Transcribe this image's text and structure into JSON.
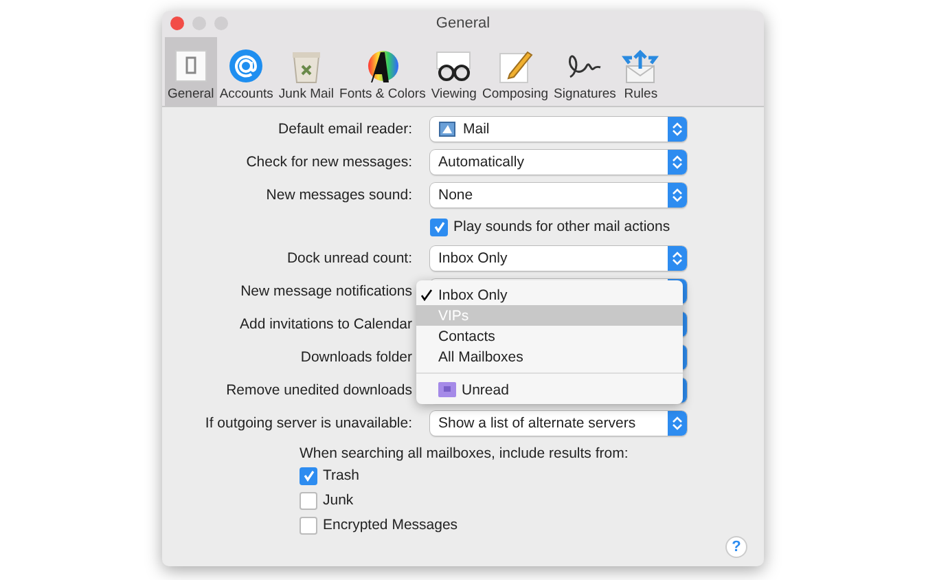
{
  "window": {
    "title": "General"
  },
  "toolbar": [
    {
      "label": "General",
      "selected": true
    },
    {
      "label": "Accounts",
      "selected": false
    },
    {
      "label": "Junk Mail",
      "selected": false
    },
    {
      "label": "Fonts & Colors",
      "selected": false
    },
    {
      "label": "Viewing",
      "selected": false
    },
    {
      "label": "Composing",
      "selected": false
    },
    {
      "label": "Signatures",
      "selected": false
    },
    {
      "label": "Rules",
      "selected": false
    }
  ],
  "settings": [
    {
      "kind": "app_popup",
      "label": "Default email reader:",
      "value": "Mail"
    },
    {
      "kind": "popup",
      "label": "Check for new messages:",
      "value": "Automatically"
    },
    {
      "kind": "popup",
      "label": "New messages sound:",
      "value": "None"
    },
    {
      "kind": "checkbox",
      "label": "Play sounds for other mail actions",
      "checked": true
    },
    {
      "kind": "popup",
      "label": "Dock unread count:",
      "value": "Inbox Only"
    },
    {
      "kind": "popup",
      "label": "New message notifications"
    },
    {
      "kind": "popup",
      "label": "Add invitations to Calendar"
    },
    {
      "kind": "popup",
      "label": "Downloads folder"
    },
    {
      "kind": "popup",
      "label": "Remove unedited downloads"
    },
    {
      "kind": "popup",
      "label": "If outgoing server is unavailable:",
      "value": "Show a list of alternate servers"
    }
  ],
  "search_section": {
    "heading": "When searching all mailboxes, include results from:",
    "options": [
      {
        "label": "Trash",
        "checked": true
      },
      {
        "label": "Junk",
        "checked": false
      },
      {
        "label": "Encrypted Messages",
        "checked": false
      }
    ]
  },
  "dropdown_menu": [
    {
      "kind": "item",
      "label": "Inbox Only",
      "checked": true,
      "selected": false
    },
    {
      "kind": "item",
      "label": "VIPs",
      "checked": false,
      "selected": true
    },
    {
      "kind": "item",
      "label": "Contacts",
      "checked": false,
      "selected": false
    },
    {
      "kind": "item",
      "label": "All Mailboxes",
      "checked": false,
      "selected": false
    },
    {
      "kind": "separator"
    },
    {
      "kind": "mailbox",
      "label": "Unread",
      "checked": false,
      "selected": false
    }
  ],
  "help_button": {
    "label": "?"
  }
}
